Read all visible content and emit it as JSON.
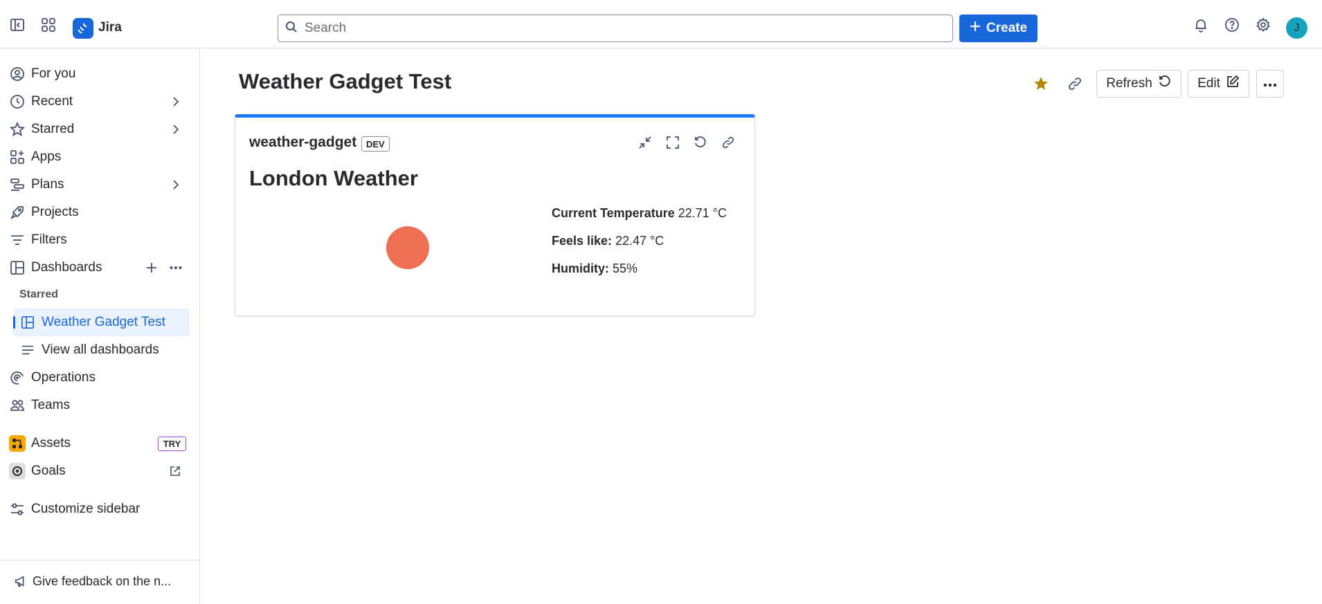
{
  "app": {
    "name": "Jira"
  },
  "search": {
    "placeholder": "Search"
  },
  "topbar": {
    "create_label": "Create",
    "avatar_initial": "J"
  },
  "sidebar": {
    "items": [
      {
        "label": "For you"
      },
      {
        "label": "Recent"
      },
      {
        "label": "Starred"
      },
      {
        "label": "Apps"
      },
      {
        "label": "Plans"
      },
      {
        "label": "Projects"
      },
      {
        "label": "Filters"
      },
      {
        "label": "Dashboards"
      },
      {
        "label": "Operations"
      },
      {
        "label": "Teams"
      },
      {
        "label": "Assets"
      },
      {
        "label": "Goals"
      },
      {
        "label": "Customize sidebar"
      }
    ],
    "section_starred": "Starred",
    "starred_dashboard": "Weather Gadget Test",
    "view_all": "View all dashboards",
    "assets_badge": "TRY",
    "feedback": "Give feedback on the n..."
  },
  "dashboard": {
    "title": "Weather Gadget Test",
    "refresh_label": "Refresh",
    "edit_label": "Edit",
    "star_color": "#b38600"
  },
  "gadget": {
    "name": "weather-gadget",
    "badge": "DEV",
    "heading": "London Weather",
    "icon_color": "#ee6f52",
    "stats": {
      "temp_label": "Current Temperature",
      "temp_value": "22.71 °C",
      "feels_label": "Feels like:",
      "feels_value": "22.47 °C",
      "humidity_label": "Humidity:",
      "humidity_value": "55%"
    }
  }
}
